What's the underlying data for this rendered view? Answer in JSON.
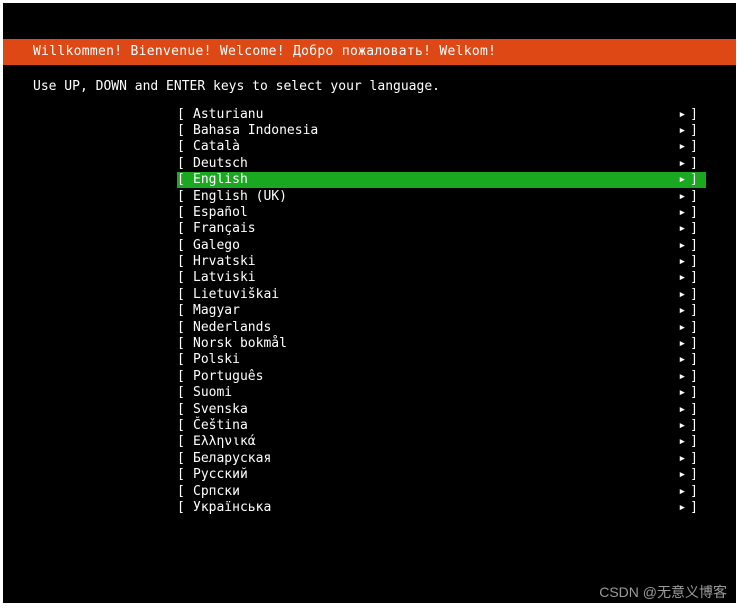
{
  "header": {
    "title": "Willkommen! Bienvenue! Welcome! Добро пожаловать! Welkom!"
  },
  "instruction": "Use UP, DOWN and ENTER keys to select your language.",
  "brackets": {
    "left": "[",
    "right": "]",
    "arrow": "▸"
  },
  "languages": [
    {
      "name": "Asturianu",
      "selected": false
    },
    {
      "name": "Bahasa Indonesia",
      "selected": false
    },
    {
      "name": "Català",
      "selected": false
    },
    {
      "name": "Deutsch",
      "selected": false
    },
    {
      "name": "English",
      "selected": true
    },
    {
      "name": "English (UK)",
      "selected": false
    },
    {
      "name": "Español",
      "selected": false
    },
    {
      "name": "Français",
      "selected": false
    },
    {
      "name": "Galego",
      "selected": false
    },
    {
      "name": "Hrvatski",
      "selected": false
    },
    {
      "name": "Latviski",
      "selected": false
    },
    {
      "name": "Lietuviškai",
      "selected": false
    },
    {
      "name": "Magyar",
      "selected": false
    },
    {
      "name": "Nederlands",
      "selected": false
    },
    {
      "name": "Norsk bokmål",
      "selected": false
    },
    {
      "name": "Polski",
      "selected": false
    },
    {
      "name": "Português",
      "selected": false
    },
    {
      "name": "Suomi",
      "selected": false
    },
    {
      "name": "Svenska",
      "selected": false
    },
    {
      "name": "Čeština",
      "selected": false
    },
    {
      "name": "Ελληνικά",
      "selected": false
    },
    {
      "name": "Беларуская",
      "selected": false
    },
    {
      "name": "Русский",
      "selected": false
    },
    {
      "name": "Српски",
      "selected": false
    },
    {
      "name": "Українська",
      "selected": false
    }
  ],
  "watermark": "CSDN @无意义博客"
}
